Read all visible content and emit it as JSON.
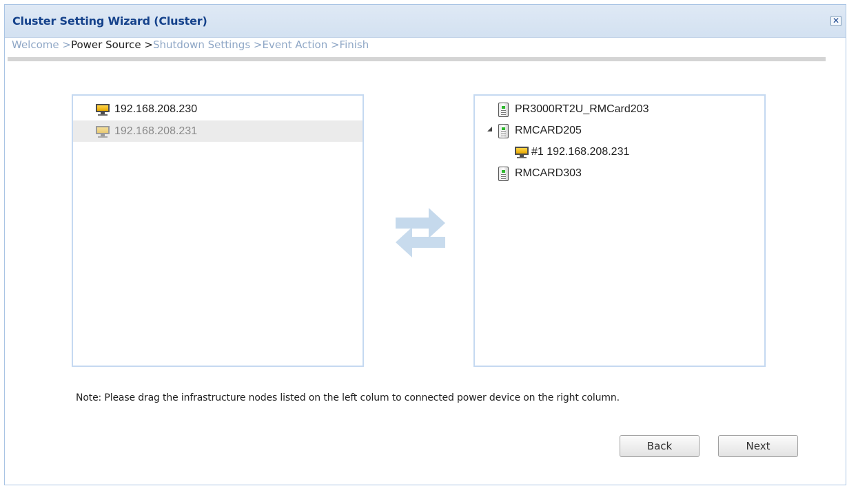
{
  "dialog": {
    "title": "Cluster Setting Wizard (Cluster)",
    "close_glyph": "✕"
  },
  "breadcrumb": {
    "steps": [
      {
        "label": "Welcome",
        "current": false
      },
      {
        "label": "Power Source",
        "current": true
      },
      {
        "label": "Shutdown Settings",
        "current": false
      },
      {
        "label": "Event Action",
        "current": false
      },
      {
        "label": "Finish",
        "current": false
      }
    ],
    "separator": " >"
  },
  "left_panel": {
    "items": [
      {
        "label": "192.168.208.230",
        "icon": "monitor-icon",
        "selected": false
      },
      {
        "label": "192.168.208.231",
        "icon": "monitor-icon",
        "selected": true
      }
    ]
  },
  "right_panel": {
    "items": [
      {
        "label": "PR3000RT2U_RMCard203",
        "icon": "ups-icon",
        "expanded": false,
        "children": []
      },
      {
        "label": "RMCARD205",
        "icon": "ups-icon",
        "expanded": true,
        "children": [
          {
            "label": "#1 192.168.208.231",
            "icon": "monitor-icon"
          }
        ]
      },
      {
        "label": "RMCARD303",
        "icon": "ups-icon",
        "expanded": false,
        "children": []
      }
    ]
  },
  "transfer_icon": "swap-arrows-icon",
  "note": "Note: Please drag the infrastructure nodes listed on the left colum to connected power device on the right column.",
  "buttons": {
    "back": "Back",
    "next": "Next"
  },
  "colors": {
    "title": "#15428b",
    "breadcrumb_inactive": "#8fa7c6",
    "panel_border": "#c5d9f1",
    "selected_row": "#ebebeb",
    "swap_arrows": "#c5d9ec"
  }
}
